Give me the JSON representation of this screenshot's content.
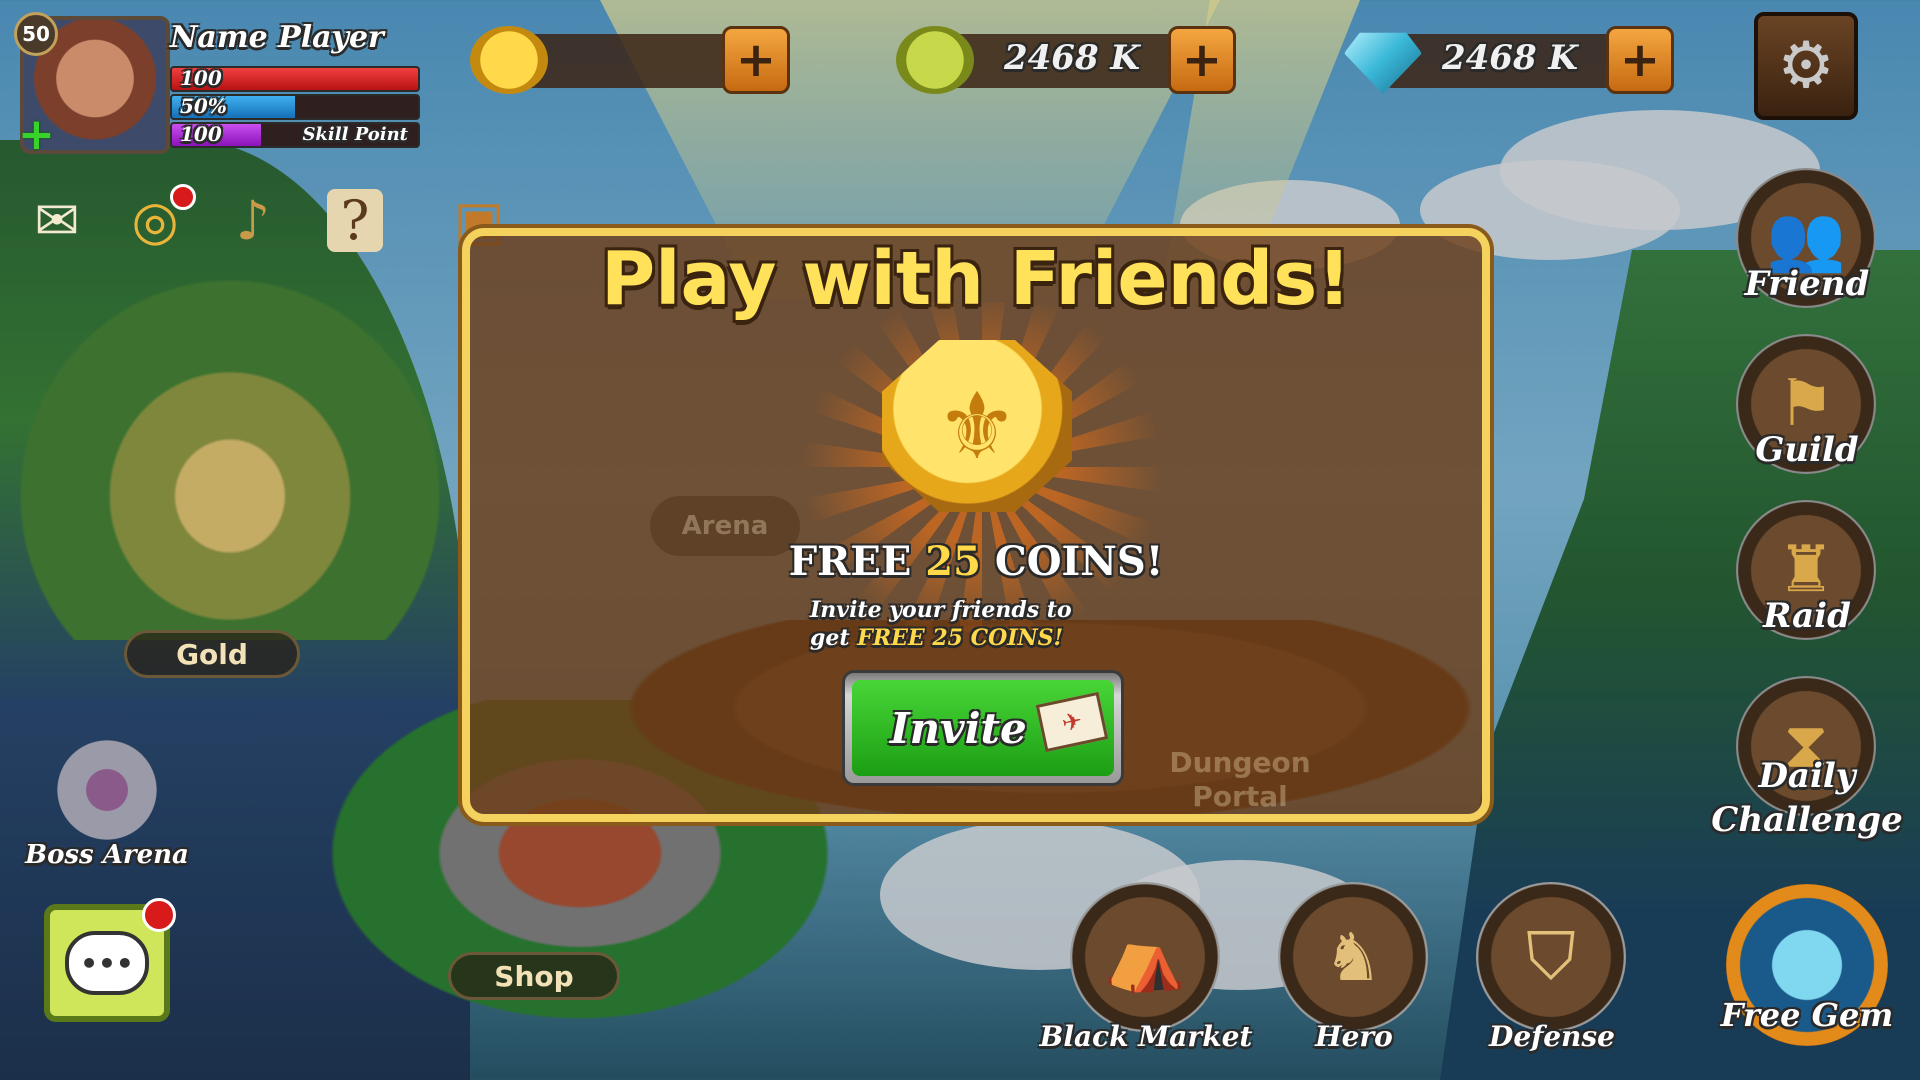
{
  "player": {
    "level": "50",
    "name": "Name Player",
    "hp": "100",
    "exp": "50%",
    "exp_fraction": 0.5,
    "skill_value": "100",
    "skill_label": "Skill Point"
  },
  "currencies": [
    {
      "icon": "gold-coin-icon",
      "value": ""
    },
    {
      "icon": "food-icon",
      "value": "2468 K"
    },
    {
      "icon": "gem-icon",
      "value": "2468 K"
    }
  ],
  "top_icons": [
    {
      "name": "mail-icon",
      "glyph": "✉"
    },
    {
      "name": "spin-wheel-icon",
      "glyph": "◎"
    },
    {
      "name": "bell-icon",
      "glyph": "🔔"
    },
    {
      "name": "quest-calendar-icon",
      "glyph": "?"
    },
    {
      "name": "treasure-chest-icon",
      "glyph": "▣"
    }
  ],
  "map": {
    "gold_label": "Gold",
    "shop_label": "Shop",
    "arena_label": "Arena",
    "dungeon_label_1": "Dungeon",
    "dungeon_label_2": "Portal",
    "boss_arena_label": "Boss Arena"
  },
  "side_menu": {
    "friend": "Friend",
    "guild": "Guild",
    "raid": "Raid",
    "daily_1": "Daily",
    "daily_2": "Challenge",
    "free_gem": "Free Gem"
  },
  "bottom_menu": {
    "black_market": "Black Market",
    "hero": "Hero",
    "defense": "Defense"
  },
  "modal": {
    "title": "Play with Friends!",
    "free_prefix": "FREE",
    "free_amount": "25",
    "free_suffix": "COINS!",
    "invite_line1": "Invite your friends to",
    "invite_line2_prefix": "get",
    "invite_line2_highlight": "FREE 25 COINS!",
    "invite_button": "Invite"
  },
  "colors": {
    "accent_gold": "#f5d15e",
    "button_green": "#2ab31e",
    "hp_red": "#d61c1c",
    "exp_blue": "#1f8fd6",
    "skill_purple": "#a11fd1"
  }
}
